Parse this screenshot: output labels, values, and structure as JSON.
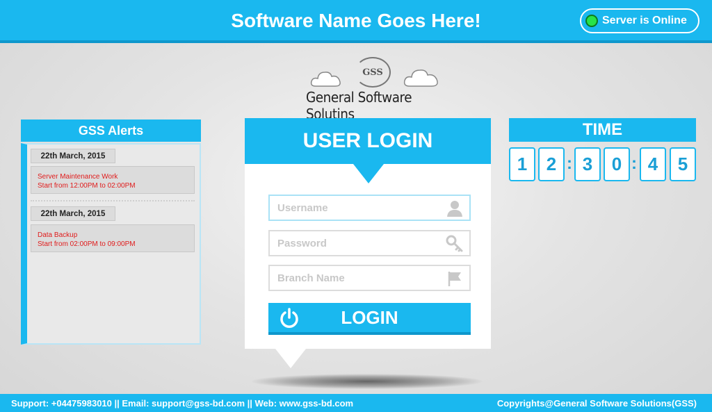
{
  "header": {
    "title": "Software Name Goes Here!",
    "server_status": "Server is Online",
    "status_color": "#27e34a"
  },
  "logo": {
    "mark": "GSS",
    "company": "General Software Solutins"
  },
  "alerts": {
    "title": "GSS Alerts",
    "items": [
      {
        "date": "22th March, 2015",
        "line1": "Server Maintenance Work",
        "line2": "Start from 12:00PM to 02:00PM"
      },
      {
        "date": "22th March, 2015",
        "line1": "Data Backup",
        "line2": "Start from 02:00PM to 09:00PM"
      }
    ]
  },
  "login": {
    "title": "USER LOGIN",
    "username_placeholder": "Username",
    "password_placeholder": "Password",
    "branch_placeholder": "Branch Name",
    "button_label": "LOGIN"
  },
  "time": {
    "title": "TIME",
    "digits": [
      "1",
      "2",
      "3",
      "0",
      "4",
      "5"
    ],
    "separator": ":"
  },
  "footer": {
    "contact": "Support: +04475983010 || Email: support@gss-bd.com || Web: www.gss-bd.com",
    "copyright": "Copyrights@General Software Solutions(GSS)"
  },
  "colors": {
    "accent": "#1ab8ef",
    "alert_text": "#e01b1b"
  }
}
